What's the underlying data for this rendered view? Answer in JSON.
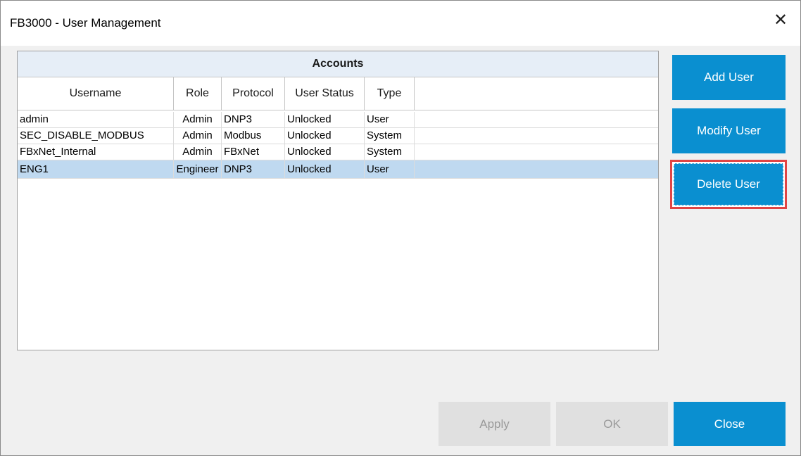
{
  "window": {
    "title": "FB3000 - User Management",
    "close_glyph": "✕"
  },
  "accounts": {
    "title": "Accounts",
    "columns": [
      "Username",
      "Role",
      "Protocol",
      "User Status",
      "Type"
    ],
    "rows": [
      {
        "username": "admin",
        "role": "Admin",
        "protocol": "DNP3",
        "status": "Unlocked",
        "type": "User",
        "selected": false
      },
      {
        "username": "SEC_DISABLE_MODBUS",
        "role": "Admin",
        "protocol": "Modbus",
        "status": "Unlocked",
        "type": "System",
        "selected": false
      },
      {
        "username": "FBxNet_Internal",
        "role": "Admin",
        "protocol": "FBxNet",
        "status": "Unlocked",
        "type": "System",
        "selected": false
      },
      {
        "username": "ENG1",
        "role": "Engineer",
        "protocol": "DNP3",
        "status": "Unlocked",
        "type": "User",
        "selected": true
      }
    ]
  },
  "side_buttons": {
    "add": "Add User",
    "modify": "Modify User",
    "delete": "Delete User"
  },
  "bottom_buttons": {
    "apply": "Apply",
    "ok": "OK",
    "close": "Close"
  },
  "colors": {
    "accent": "#0a8fd0",
    "selection": "#bfd9f0",
    "highlight_border": "#e04545"
  }
}
